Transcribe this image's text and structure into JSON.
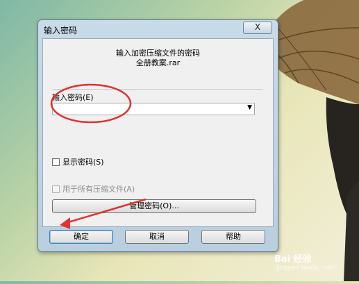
{
  "dialog": {
    "title": "输入密码",
    "close_label": "X",
    "prompt_line1": "输入加密压缩文件的密码",
    "prompt_line2": "全册教案.rar",
    "password_label": "输入密码(E)",
    "password_value": "",
    "show_password_label": "显示密码(S)",
    "use_all_label": "用于所有压缩文件(A)",
    "manage_button": "管理密码(O)...",
    "ok_button": "确定",
    "cancel_button": "取消",
    "help_button": "帮助"
  },
  "watermark": {
    "text": "Bai 经验",
    "sub": "jingyan.baidu.com"
  },
  "colors": {
    "annotation_red": "#e0322f"
  }
}
